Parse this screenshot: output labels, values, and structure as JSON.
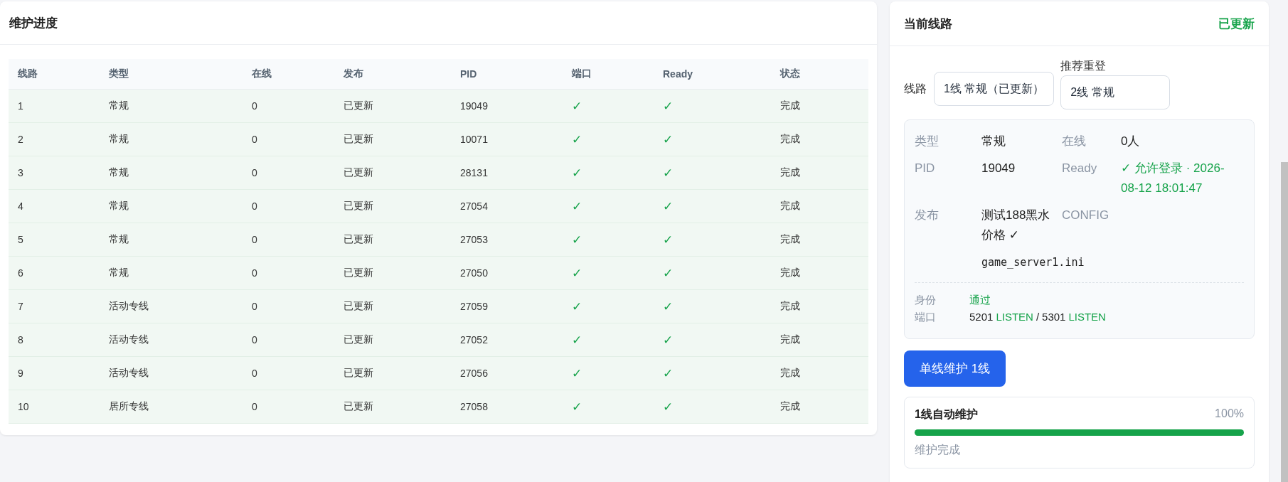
{
  "progress_panel": {
    "title": "维护进度",
    "table": {
      "columns": [
        "线路",
        "类型",
        "在线",
        "发布",
        "PID",
        "端口",
        "Ready",
        "状态"
      ],
      "rows": [
        {
          "cells": [
            "1",
            "常规",
            "0",
            "已更新",
            "19049",
            "✓",
            "✓",
            "完成"
          ]
        },
        {
          "cells": [
            "2",
            "常规",
            "0",
            "已更新",
            "10071",
            "✓",
            "✓",
            "完成"
          ]
        },
        {
          "cells": [
            "3",
            "常规",
            "0",
            "已更新",
            "28131",
            "✓",
            "✓",
            "完成"
          ]
        },
        {
          "cells": [
            "4",
            "常规",
            "0",
            "已更新",
            "27054",
            "✓",
            "✓",
            "完成"
          ]
        },
        {
          "cells": [
            "5",
            "常规",
            "0",
            "已更新",
            "27053",
            "✓",
            "✓",
            "完成"
          ]
        },
        {
          "cells": [
            "6",
            "常规",
            "0",
            "已更新",
            "27050",
            "✓",
            "✓",
            "完成"
          ]
        },
        {
          "cells": [
            "7",
            "活动专线",
            "0",
            "已更新",
            "27059",
            "✓",
            "✓",
            "完成"
          ]
        },
        {
          "cells": [
            "8",
            "活动专线",
            "0",
            "已更新",
            "27052",
            "✓",
            "✓",
            "完成"
          ]
        },
        {
          "cells": [
            "9",
            "活动专线",
            "0",
            "已更新",
            "27056",
            "✓",
            "✓",
            "完成"
          ]
        },
        {
          "cells": [
            "10",
            "居所专线",
            "0",
            "已更新",
            "27058",
            "✓",
            "✓",
            "完成"
          ]
        }
      ]
    }
  },
  "current_line": {
    "title": "当前线路",
    "status": "已更新",
    "line_label": "线路",
    "line_value": "1线 常规（已更新）",
    "relogin_label": "推荐重登",
    "relogin_value": "2线 常规",
    "fields": [
      {
        "label": "类型",
        "value": "常规",
        "kind": "text"
      },
      {
        "label": "在线",
        "value": "0人",
        "kind": "text"
      },
      {
        "label": "PID",
        "value": "19049",
        "kind": "text"
      },
      {
        "label": "Ready",
        "value": "✓ 允许登录 · 2026-08-12 18:01:47",
        "kind": "ok"
      },
      {
        "label": "发布",
        "value": "测试188黑水价格 ✓",
        "kind": "text"
      },
      {
        "label": "CONFIG",
        "value": "game_server1.ini",
        "kind": "mono"
      }
    ],
    "identity_label": "身份",
    "identity_value": "通过",
    "port_label": "端口",
    "ports": [
      {
        "port": "5201",
        "state": "LISTEN"
      },
      {
        "port": "5301",
        "state": "LISTEN"
      }
    ],
    "port_separator": "/",
    "button": "单线维护 1线",
    "task": {
      "title": "1线自动维护",
      "percent": "100%",
      "level": 1,
      "status": "维护完成"
    }
  }
}
